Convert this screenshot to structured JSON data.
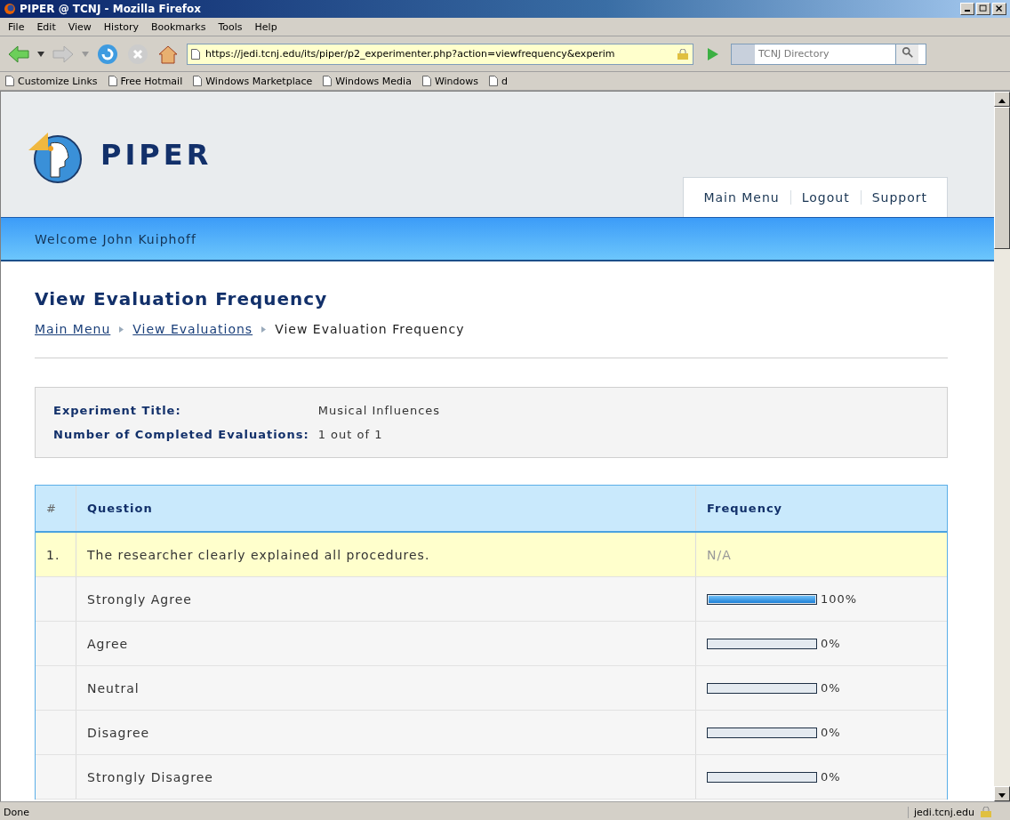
{
  "window": {
    "title": "PIPER @ TCNJ - Mozilla Firefox"
  },
  "menu": [
    "File",
    "Edit",
    "View",
    "History",
    "Bookmarks",
    "Tools",
    "Help"
  ],
  "toolbar": {
    "url": "https://jedi.tcnj.edu/its/piper/p2_experimenter.php?action=viewfrequency&experim",
    "search": {
      "placeholder": "TCNJ Directory"
    }
  },
  "bookmarks": [
    "Customize Links",
    "Free Hotmail",
    "Windows Marketplace",
    "Windows Media",
    "Windows",
    "d"
  ],
  "site": {
    "logo": "PIPER",
    "nav": [
      "Main Menu",
      "Logout",
      "Support"
    ],
    "welcome": "Welcome John Kuiphoff"
  },
  "page": {
    "title": "View Evaluation Frequency",
    "breadcrumbs": [
      {
        "label": "Main Menu",
        "link": true
      },
      {
        "label": "View Evaluations",
        "link": true
      },
      {
        "label": "View Evaluation Frequency",
        "link": false
      }
    ],
    "info": [
      {
        "label": "Experiment Title:",
        "value": "Musical Influences"
      },
      {
        "label": "Number of Completed Evaluations:",
        "value": "1 out of 1"
      }
    ]
  },
  "table": {
    "columns": [
      "#",
      "Question",
      "Frequency"
    ],
    "rows": [
      {
        "kind": "question",
        "number": "1.",
        "text": "The researcher clearly explained all procedures.",
        "frequency": "N/A"
      },
      {
        "kind": "answer",
        "text": "Strongly Agree",
        "level": 1,
        "reading": "100%"
      },
      {
        "kind": "answer",
        "text": "Agree",
        "level": 0,
        "reading": "0%"
      },
      {
        "kind": "answer",
        "text": "Neutral",
        "level": 0,
        "reading": "0%"
      },
      {
        "kind": "answer",
        "text": "Disagree",
        "level": 0,
        "reading": "0%"
      },
      {
        "kind": "answer",
        "text": "Strongly Disagree",
        "level": 0,
        "reading": "0%"
      }
    ]
  },
  "status_bar": {
    "text": "Done",
    "host": "jedi.tcnj.edu"
  }
}
